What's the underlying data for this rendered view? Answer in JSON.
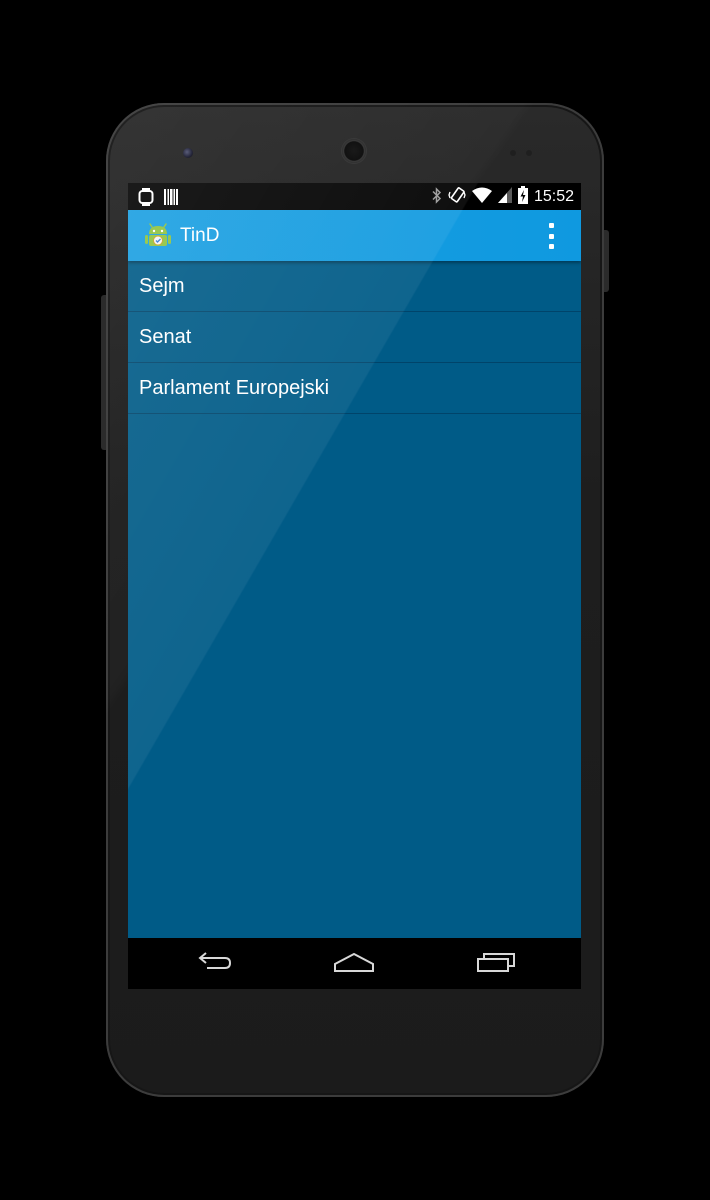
{
  "statusbar": {
    "time": "15:52",
    "left_icons": [
      "watch-icon",
      "barcode-icon"
    ],
    "right_icons": [
      "bluetooth-icon",
      "vibrate-icon",
      "wifi-icon",
      "signal-icon",
      "battery-charging-icon"
    ]
  },
  "actionbar": {
    "title": "TinD",
    "app_icon": "android-app-icon",
    "overflow_icon": "overflow-menu-icon"
  },
  "list": {
    "items": [
      {
        "label": "Sejm"
      },
      {
        "label": "Senat"
      },
      {
        "label": "Parlament Europejski"
      }
    ]
  },
  "navbar": {
    "icons": [
      "back-icon",
      "home-icon",
      "recents-icon"
    ]
  },
  "colors": {
    "actionbar": "#1a9fe1",
    "background": "#005b87",
    "text": "#ffffff"
  }
}
